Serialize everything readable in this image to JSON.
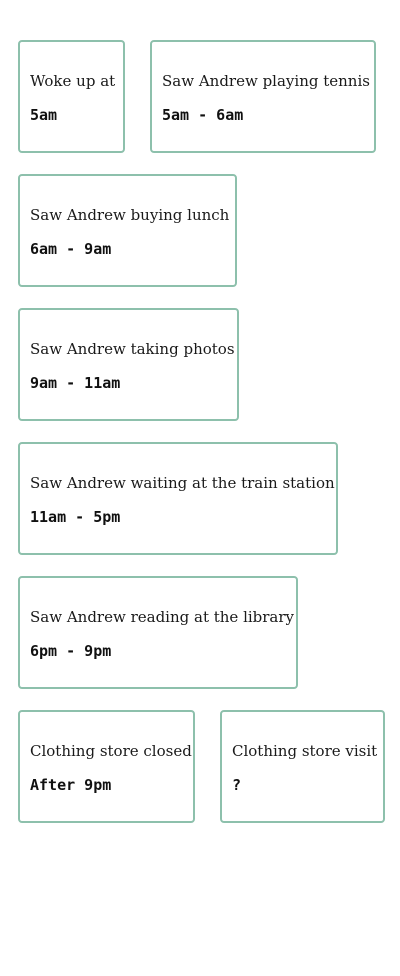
{
  "clues": [
    {
      "label": "Woke up at",
      "time": "5am"
    },
    {
      "label": "Saw Andrew playing tennis",
      "time": "5am - 6am"
    },
    {
      "label": "Saw Andrew buying lunch",
      "time": "6am - 9am"
    },
    {
      "label": "Saw Andrew taking photos",
      "time": "9am - 11am"
    },
    {
      "label": "Saw Andrew waiting at the train station",
      "time": "11am - 5pm"
    },
    {
      "label": "Saw Andrew reading at the library",
      "time": "6pm - 9pm"
    },
    {
      "label": "Clothing store closed",
      "time": "After 9pm"
    },
    {
      "label": "Clothing store visit",
      "time": "?"
    }
  ],
  "colors": {
    "card_border": "#8dc0ac",
    "text": "#111111",
    "background": "#ffffff"
  }
}
